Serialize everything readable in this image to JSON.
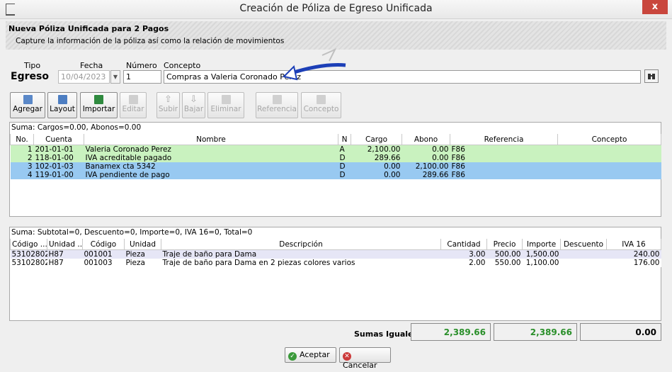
{
  "window": {
    "title": "Creación de Póliza de Egreso Unificada",
    "close_glyph": "x"
  },
  "header": {
    "title": "Nueva Póliza Unificada para 2 Pagos",
    "subtitle": "Capture la información de la póliza así como la relación de movimientos"
  },
  "form": {
    "tipo_label": "Tipo",
    "tipo_value": "Egreso",
    "fecha_label": "Fecha",
    "fecha_value": "10/04/2023",
    "numero_label": "Número",
    "numero_value": "1",
    "concepto_label": "Concepto",
    "concepto_value": "Compras a  Valeria Coronado Perez"
  },
  "toolbar": [
    {
      "label": "Agregar",
      "icon": "add-icon",
      "enabled": true
    },
    {
      "label": "Layout",
      "icon": "layout-icon",
      "enabled": true
    },
    {
      "label": "Importar",
      "icon": "excel-icon",
      "enabled": true
    },
    {
      "label": "Editar",
      "icon": "edit-icon",
      "enabled": false
    },
    {
      "label": "Subir",
      "icon": "arrow-up-icon",
      "enabled": false
    },
    {
      "label": "Bajar",
      "icon": "arrow-down-icon",
      "enabled": false
    },
    {
      "label": "Eliminar",
      "icon": "delete-icon",
      "enabled": false
    },
    {
      "label": "Referencia",
      "icon": "reference-icon",
      "enabled": false
    },
    {
      "label": "Concepto",
      "icon": "concept-icon",
      "enabled": false
    }
  ],
  "movimientos": {
    "summary": "Suma: Cargos=0.00, Abonos=0.00",
    "columns": [
      "No.",
      "Cuenta",
      "Nombre",
      "N",
      "Cargo",
      "Abono",
      "Referencia",
      "Concepto"
    ],
    "rows": [
      {
        "no": "1",
        "cuenta": "201-01-01",
        "nombre": "Valeria Coronado Perez",
        "n": "A",
        "cargo": "2,100.00",
        "abono": "0.00",
        "referencia": "F86",
        "concepto": ""
      },
      {
        "no": "2",
        "cuenta": "118-01-00",
        "nombre": "IVA acreditable pagado",
        "n": "D",
        "cargo": "289.66",
        "abono": "0.00",
        "referencia": "F86",
        "concepto": ""
      },
      {
        "no": "3",
        "cuenta": "102-01-03",
        "nombre": "Banamex cta 5342",
        "n": "D",
        "cargo": "0.00",
        "abono": "2,100.00",
        "referencia": "F86",
        "concepto": ""
      },
      {
        "no": "4",
        "cuenta": "119-01-00",
        "nombre": "IVA pendiente de pago",
        "n": "D",
        "cargo": "0.00",
        "abono": "289.66",
        "referencia": "F86",
        "concepto": ""
      }
    ]
  },
  "conceptos": {
    "summary": "Suma: Subtotal=0, Descuento=0, Importe=0, IVA 16=0, Total=0",
    "columns": [
      "Código ...",
      "Unidad ...",
      "Código",
      "Unidad",
      "Descripción",
      "Cantidad",
      "Precio",
      "Importe",
      "Descuento",
      "IVA 16"
    ],
    "rows": [
      {
        "codigo_sat": "53102802",
        "unidad_sat": "H87",
        "codigo": "001001",
        "unidad": "Pieza",
        "descripcion": "Traje de baño para Dama",
        "cantidad": "3.00",
        "precio": "500.00",
        "importe": "1,500.00",
        "descuento": "",
        "iva": "240.00"
      },
      {
        "codigo_sat": "53102802",
        "unidad_sat": "H87",
        "codigo": "001003",
        "unidad": "Pieza",
        "descripcion": "Traje de baño para Dama en 2 piezas colores varios",
        "cantidad": "2.00",
        "precio": "550.00",
        "importe": "1,100.00",
        "descuento": "",
        "iva": "176.00"
      }
    ]
  },
  "totals": {
    "label": "Sumas Iguales:",
    "cargos": "2,389.66",
    "abonos": "2,389.66",
    "diferencia": "0.00"
  },
  "buttons": {
    "accept": "Aceptar",
    "cancel": "Cancelar"
  },
  "colors": {
    "row_green": "#c9f2bf",
    "row_blue": "#98c9f1",
    "totals_green": "#2a8f2a",
    "close_red": "#c9463d"
  }
}
